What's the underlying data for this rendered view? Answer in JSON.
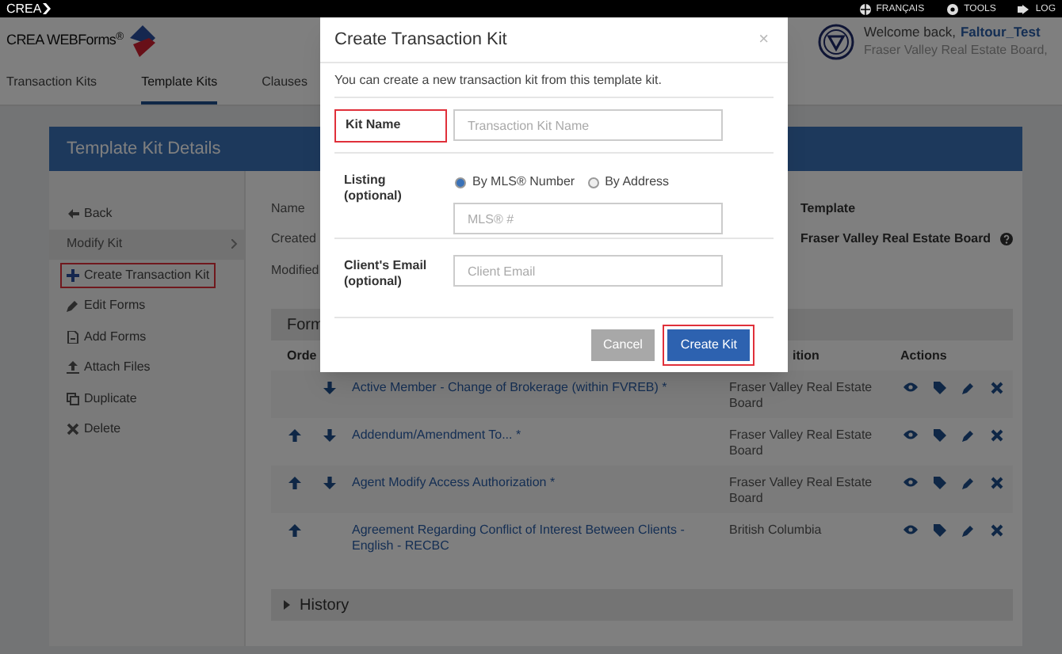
{
  "top_bar": {
    "brand": "CREA",
    "links": [
      {
        "label": "FRANÇAIS",
        "kind": "globe"
      },
      {
        "label": "TOOLS",
        "kind": "gear"
      },
      {
        "label": "LOG",
        "kind": "signout"
      }
    ]
  },
  "header": {
    "logo": "CREA WEBForms$^{®}$",
    "greeting": "Welcome back,",
    "user": "Faltour_Test",
    "board": "Fraser Valley Real Estate Board,"
  },
  "nav": [
    {
      "label": "Transaction Kits",
      "selected": false
    },
    {
      "label": "Template Kits",
      "selected": true
    },
    {
      "label": "Clauses",
      "selected": false
    }
  ],
  "card": {
    "title": "Template Kit Details",
    "sidebar": [
      {
        "label": "Back",
        "kind": "back",
        "highlighted": false
      },
      {
        "label": "Modify Kit",
        "kind": "group",
        "highlighted": false
      },
      {
        "label": "Create Transaction Kit",
        "kind": "plus",
        "highlighted": true
      },
      {
        "label": "Edit Forms",
        "kind": "pencil",
        "highlighted": false
      },
      {
        "label": "Add Forms",
        "kind": "file",
        "highlighted": false
      },
      {
        "label": "Attach Files",
        "kind": "upload",
        "highlighted": false
      },
      {
        "label": "Duplicate",
        "kind": "copy",
        "highlighted": false
      },
      {
        "label": "Delete",
        "kind": "delete",
        "highlighted": false
      }
    ],
    "details": [
      "Name",
      "Created",
      "Modified"
    ],
    "template": {
      "label": "Template",
      "value": "Fraser Valley Real Estate Board"
    },
    "forms": {
      "title": "Form",
      "columns": [
        "Orde",
        "ition",
        "Actions"
      ],
      "rows": [
        {
          "up": false,
          "down": true,
          "name": "Active Member - Change of Brokerage (within FVREB) *",
          "position": "Fraser Valley Real Estate Board"
        },
        {
          "up": true,
          "down": true,
          "name": "Addendum/Amendment To... *",
          "position": "Fraser Valley Real Estate Board"
        },
        {
          "up": true,
          "down": true,
          "name": "Agent Modify Access Authorization *",
          "position": "Fraser Valley Real Estate Board"
        },
        {
          "up": true,
          "down": false,
          "name": "Agreement Regarding Conflict of Interest Between Clients - English - RECBC",
          "position": "British Columbia"
        }
      ]
    },
    "history": {
      "label": "History",
      "expanded": false
    }
  },
  "modal": {
    "title": "Create Transaction Kit",
    "close": "×",
    "intro": "You can create a new transaction kit from this template kit.",
    "kit_name": {
      "label": "Kit Name",
      "placeholder": "Transaction Kit Name",
      "highlighted": true
    },
    "listing": {
      "label": "Listing",
      "note": "(optional)",
      "options": [
        {
          "label": "By MLS® Number",
          "selected": true
        },
        {
          "label": "By Address",
          "selected": false
        }
      ],
      "placeholder": "MLS® #"
    },
    "email": {
      "label": "Client's Email",
      "note": "(optional)",
      "placeholder": "Client Email"
    },
    "buttons": [
      {
        "label": "Cancel",
        "kind": "secondary",
        "highlighted": false
      },
      {
        "label": "Create Kit",
        "kind": "primary",
        "highlighted": true
      }
    ]
  }
}
